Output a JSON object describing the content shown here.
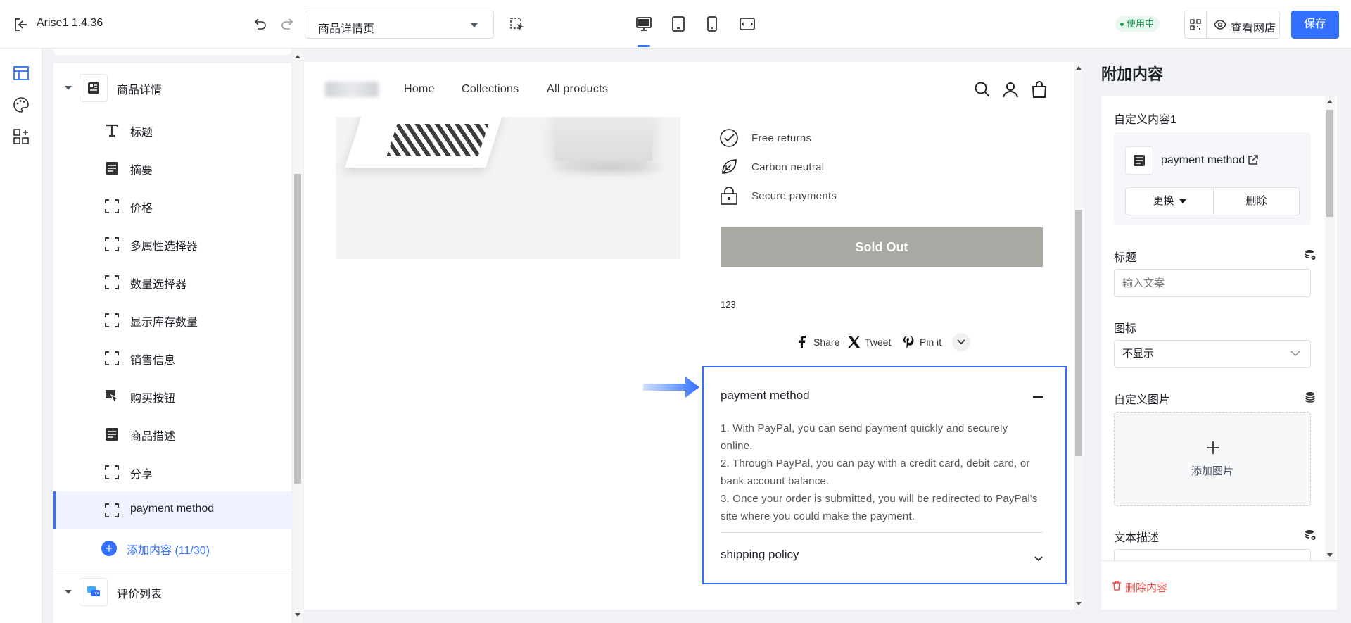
{
  "topbar": {
    "app_name": "Arise1  1.4.36",
    "page_select_value": "商品详情页",
    "status_badge": "使用中",
    "view_store_label": "查看网店",
    "save_label": "保存"
  },
  "tree": {
    "group_product": "商品详情",
    "items": [
      {
        "label": "标题",
        "icon": "text-icon"
      },
      {
        "label": "摘要",
        "icon": "doc-icon"
      },
      {
        "label": "价格",
        "icon": "frame-icon"
      },
      {
        "label": "多属性选择器",
        "icon": "frame-icon"
      },
      {
        "label": "数量选择器",
        "icon": "frame-icon"
      },
      {
        "label": "显示库存数量",
        "icon": "frame-icon"
      },
      {
        "label": "销售信息",
        "icon": "frame-icon"
      },
      {
        "label": "购买按钮",
        "icon": "cursor-icon"
      },
      {
        "label": "商品描述",
        "icon": "doc-icon"
      },
      {
        "label": "分享",
        "icon": "frame-icon"
      },
      {
        "label": "payment method",
        "icon": "frame-icon"
      }
    ],
    "add_content": "添加内容 (11/30)",
    "group_reviews": "评价列表"
  },
  "preview": {
    "nav": {
      "home": "Home",
      "collections": "Collections",
      "all_products": "All products"
    },
    "features": [
      "Free returns",
      "Carbon neutral",
      "Secure payments"
    ],
    "sold_out": "Sold Out",
    "small_text": "123",
    "share": {
      "share": "Share",
      "tweet": "Tweet",
      "pin": "Pin it"
    },
    "accordion": {
      "title": "payment method",
      "lines": [
        "1. With PayPal, you can send payment quickly and securely online.",
        "2. Through PayPal, you can pay with a credit card, debit card, or bank account balance.",
        "3. Once your order is submitted, you will be redirected to PayPal's site where you could make the payment."
      ],
      "next_title": "shipping policy"
    }
  },
  "right_panel": {
    "title": "附加内容",
    "custom_content_label": "自定义内容1",
    "doc_name": "payment method",
    "replace_label": "更换",
    "delete_label": "删除",
    "heading_label": "标题",
    "heading_placeholder": "输入文案",
    "icon_label": "图标",
    "icon_value": "不显示",
    "image_label": "自定义图片",
    "add_image": "添加图片",
    "text_desc_label": "文本描述",
    "delete_content": "删除内容"
  },
  "colors": {
    "accent": "#3370ff",
    "danger": "#f54a45",
    "soldout": "#a9a8a3"
  }
}
